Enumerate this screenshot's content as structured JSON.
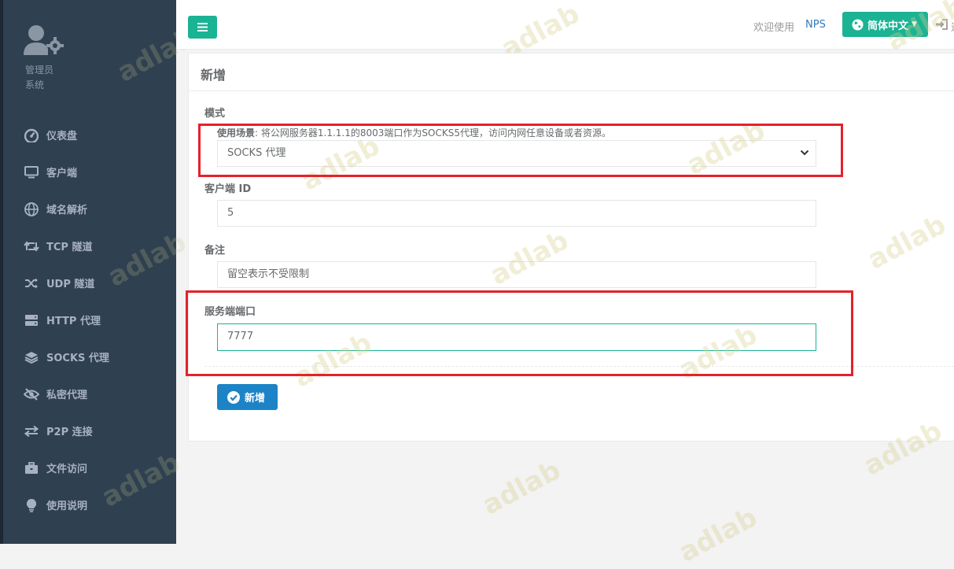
{
  "profile": {
    "role": "管理员",
    "subtitle": "系统"
  },
  "nav": [
    {
      "label": "仪表盘",
      "icon": "dashboard-icon"
    },
    {
      "label": "客户端",
      "icon": "monitor-icon"
    },
    {
      "label": "域名解析",
      "icon": "globe-icon"
    },
    {
      "label": "TCP 隧道",
      "icon": "retweet-icon"
    },
    {
      "label": "UDP 隧道",
      "icon": "random-icon"
    },
    {
      "label": "HTTP 代理",
      "icon": "server-icon"
    },
    {
      "label": "SOCKS 代理",
      "icon": "layers-icon"
    },
    {
      "label": "私密代理",
      "icon": "eye-slash-icon"
    },
    {
      "label": "P2P 连接",
      "icon": "exchange-icon"
    },
    {
      "label": "文件访问",
      "icon": "briefcase-icon"
    },
    {
      "label": "使用说明",
      "icon": "lightbulb-icon"
    }
  ],
  "topbar": {
    "welcome": "欢迎使用",
    "nps": "NPS",
    "language": "简体中文",
    "logout": "退"
  },
  "form": {
    "title": "新增",
    "mode": {
      "label": "模式",
      "hint_prefix": "使用场景",
      "hint_text": ": 将公网服务器1.1.1.1的8003端口作为SOCKS5代理，访问内网任意设备或者资源。",
      "value": "SOCKS 代理"
    },
    "client_id": {
      "label": "客户端 ID",
      "value": "5"
    },
    "remark": {
      "label": "备注",
      "placeholder": "留空表示不受限制"
    },
    "server_port": {
      "label": "服务端端口",
      "value": "7777"
    },
    "submit": "新增"
  },
  "watermark": "adlab",
  "colors": {
    "sidebar_bg": "#2f4050",
    "primary_green": "#1ab394",
    "submit_blue": "#1c84c6",
    "highlight_red": "#e5212b"
  }
}
